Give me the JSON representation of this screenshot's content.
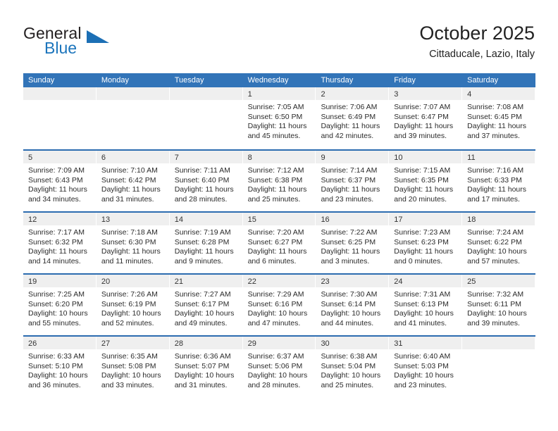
{
  "logo": {
    "word_one": "General",
    "word_two": "Blue",
    "triangle_icon": "triangle-icon",
    "brand_blue": "#1c75bc",
    "brand_dark": "#231f20"
  },
  "header": {
    "month_title": "October 2025",
    "location": "Cittaducale, Lazio, Italy"
  },
  "calendar": {
    "header_bg": "#3274b8",
    "row_border": "#2c6cb0",
    "day_band_bg": "#efefef",
    "weekdays": [
      "Sunday",
      "Monday",
      "Tuesday",
      "Wednesday",
      "Thursday",
      "Friday",
      "Saturday"
    ],
    "weeks": [
      [
        {
          "day": "",
          "empty": true,
          "sunrise": "",
          "sunset": "",
          "daylight_a": "",
          "daylight_b": ""
        },
        {
          "day": "",
          "empty": true,
          "sunrise": "",
          "sunset": "",
          "daylight_a": "",
          "daylight_b": ""
        },
        {
          "day": "",
          "empty": true,
          "sunrise": "",
          "sunset": "",
          "daylight_a": "",
          "daylight_b": ""
        },
        {
          "day": "1",
          "empty": false,
          "sunrise": "Sunrise: 7:05 AM",
          "sunset": "Sunset: 6:50 PM",
          "daylight_a": "Daylight: 11 hours",
          "daylight_b": "and 45 minutes."
        },
        {
          "day": "2",
          "empty": false,
          "sunrise": "Sunrise: 7:06 AM",
          "sunset": "Sunset: 6:49 PM",
          "daylight_a": "Daylight: 11 hours",
          "daylight_b": "and 42 minutes."
        },
        {
          "day": "3",
          "empty": false,
          "sunrise": "Sunrise: 7:07 AM",
          "sunset": "Sunset: 6:47 PM",
          "daylight_a": "Daylight: 11 hours",
          "daylight_b": "and 39 minutes."
        },
        {
          "day": "4",
          "empty": false,
          "sunrise": "Sunrise: 7:08 AM",
          "sunset": "Sunset: 6:45 PM",
          "daylight_a": "Daylight: 11 hours",
          "daylight_b": "and 37 minutes."
        }
      ],
      [
        {
          "day": "5",
          "empty": false,
          "sunrise": "Sunrise: 7:09 AM",
          "sunset": "Sunset: 6:43 PM",
          "daylight_a": "Daylight: 11 hours",
          "daylight_b": "and 34 minutes."
        },
        {
          "day": "6",
          "empty": false,
          "sunrise": "Sunrise: 7:10 AM",
          "sunset": "Sunset: 6:42 PM",
          "daylight_a": "Daylight: 11 hours",
          "daylight_b": "and 31 minutes."
        },
        {
          "day": "7",
          "empty": false,
          "sunrise": "Sunrise: 7:11 AM",
          "sunset": "Sunset: 6:40 PM",
          "daylight_a": "Daylight: 11 hours",
          "daylight_b": "and 28 minutes."
        },
        {
          "day": "8",
          "empty": false,
          "sunrise": "Sunrise: 7:12 AM",
          "sunset": "Sunset: 6:38 PM",
          "daylight_a": "Daylight: 11 hours",
          "daylight_b": "and 25 minutes."
        },
        {
          "day": "9",
          "empty": false,
          "sunrise": "Sunrise: 7:14 AM",
          "sunset": "Sunset: 6:37 PM",
          "daylight_a": "Daylight: 11 hours",
          "daylight_b": "and 23 minutes."
        },
        {
          "day": "10",
          "empty": false,
          "sunrise": "Sunrise: 7:15 AM",
          "sunset": "Sunset: 6:35 PM",
          "daylight_a": "Daylight: 11 hours",
          "daylight_b": "and 20 minutes."
        },
        {
          "day": "11",
          "empty": false,
          "sunrise": "Sunrise: 7:16 AM",
          "sunset": "Sunset: 6:33 PM",
          "daylight_a": "Daylight: 11 hours",
          "daylight_b": "and 17 minutes."
        }
      ],
      [
        {
          "day": "12",
          "empty": false,
          "sunrise": "Sunrise: 7:17 AM",
          "sunset": "Sunset: 6:32 PM",
          "daylight_a": "Daylight: 11 hours",
          "daylight_b": "and 14 minutes."
        },
        {
          "day": "13",
          "empty": false,
          "sunrise": "Sunrise: 7:18 AM",
          "sunset": "Sunset: 6:30 PM",
          "daylight_a": "Daylight: 11 hours",
          "daylight_b": "and 11 minutes."
        },
        {
          "day": "14",
          "empty": false,
          "sunrise": "Sunrise: 7:19 AM",
          "sunset": "Sunset: 6:28 PM",
          "daylight_a": "Daylight: 11 hours",
          "daylight_b": "and 9 minutes."
        },
        {
          "day": "15",
          "empty": false,
          "sunrise": "Sunrise: 7:20 AM",
          "sunset": "Sunset: 6:27 PM",
          "daylight_a": "Daylight: 11 hours",
          "daylight_b": "and 6 minutes."
        },
        {
          "day": "16",
          "empty": false,
          "sunrise": "Sunrise: 7:22 AM",
          "sunset": "Sunset: 6:25 PM",
          "daylight_a": "Daylight: 11 hours",
          "daylight_b": "and 3 minutes."
        },
        {
          "day": "17",
          "empty": false,
          "sunrise": "Sunrise: 7:23 AM",
          "sunset": "Sunset: 6:23 PM",
          "daylight_a": "Daylight: 11 hours",
          "daylight_b": "and 0 minutes."
        },
        {
          "day": "18",
          "empty": false,
          "sunrise": "Sunrise: 7:24 AM",
          "sunset": "Sunset: 6:22 PM",
          "daylight_a": "Daylight: 10 hours",
          "daylight_b": "and 57 minutes."
        }
      ],
      [
        {
          "day": "19",
          "empty": false,
          "sunrise": "Sunrise: 7:25 AM",
          "sunset": "Sunset: 6:20 PM",
          "daylight_a": "Daylight: 10 hours",
          "daylight_b": "and 55 minutes."
        },
        {
          "day": "20",
          "empty": false,
          "sunrise": "Sunrise: 7:26 AM",
          "sunset": "Sunset: 6:19 PM",
          "daylight_a": "Daylight: 10 hours",
          "daylight_b": "and 52 minutes."
        },
        {
          "day": "21",
          "empty": false,
          "sunrise": "Sunrise: 7:27 AM",
          "sunset": "Sunset: 6:17 PM",
          "daylight_a": "Daylight: 10 hours",
          "daylight_b": "and 49 minutes."
        },
        {
          "day": "22",
          "empty": false,
          "sunrise": "Sunrise: 7:29 AM",
          "sunset": "Sunset: 6:16 PM",
          "daylight_a": "Daylight: 10 hours",
          "daylight_b": "and 47 minutes."
        },
        {
          "day": "23",
          "empty": false,
          "sunrise": "Sunrise: 7:30 AM",
          "sunset": "Sunset: 6:14 PM",
          "daylight_a": "Daylight: 10 hours",
          "daylight_b": "and 44 minutes."
        },
        {
          "day": "24",
          "empty": false,
          "sunrise": "Sunrise: 7:31 AM",
          "sunset": "Sunset: 6:13 PM",
          "daylight_a": "Daylight: 10 hours",
          "daylight_b": "and 41 minutes."
        },
        {
          "day": "25",
          "empty": false,
          "sunrise": "Sunrise: 7:32 AM",
          "sunset": "Sunset: 6:11 PM",
          "daylight_a": "Daylight: 10 hours",
          "daylight_b": "and 39 minutes."
        }
      ],
      [
        {
          "day": "26",
          "empty": false,
          "sunrise": "Sunrise: 6:33 AM",
          "sunset": "Sunset: 5:10 PM",
          "daylight_a": "Daylight: 10 hours",
          "daylight_b": "and 36 minutes."
        },
        {
          "day": "27",
          "empty": false,
          "sunrise": "Sunrise: 6:35 AM",
          "sunset": "Sunset: 5:08 PM",
          "daylight_a": "Daylight: 10 hours",
          "daylight_b": "and 33 minutes."
        },
        {
          "day": "28",
          "empty": false,
          "sunrise": "Sunrise: 6:36 AM",
          "sunset": "Sunset: 5:07 PM",
          "daylight_a": "Daylight: 10 hours",
          "daylight_b": "and 31 minutes."
        },
        {
          "day": "29",
          "empty": false,
          "sunrise": "Sunrise: 6:37 AM",
          "sunset": "Sunset: 5:06 PM",
          "daylight_a": "Daylight: 10 hours",
          "daylight_b": "and 28 minutes."
        },
        {
          "day": "30",
          "empty": false,
          "sunrise": "Sunrise: 6:38 AM",
          "sunset": "Sunset: 5:04 PM",
          "daylight_a": "Daylight: 10 hours",
          "daylight_b": "and 25 minutes."
        },
        {
          "day": "31",
          "empty": false,
          "sunrise": "Sunrise: 6:40 AM",
          "sunset": "Sunset: 5:03 PM",
          "daylight_a": "Daylight: 10 hours",
          "daylight_b": "and 23 minutes."
        },
        {
          "day": "",
          "empty": true,
          "sunrise": "",
          "sunset": "",
          "daylight_a": "",
          "daylight_b": ""
        }
      ]
    ]
  }
}
